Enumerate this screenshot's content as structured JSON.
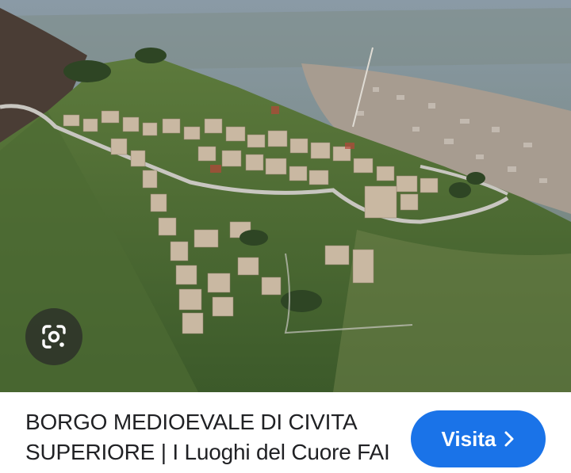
{
  "image": {
    "alt": "Aerial view of a medieval hilltop village on a green ridge with a town in the valley below"
  },
  "lens": {
    "icon": "google-lens-icon"
  },
  "result": {
    "title": "BORGO MEDIOEVALE DI CIVITA SUPERIORE | I Luoghi del Cuore FAI"
  },
  "visit_button": {
    "label": "Visita",
    "icon": "chevron-right-icon",
    "color": "#1a73e8"
  }
}
